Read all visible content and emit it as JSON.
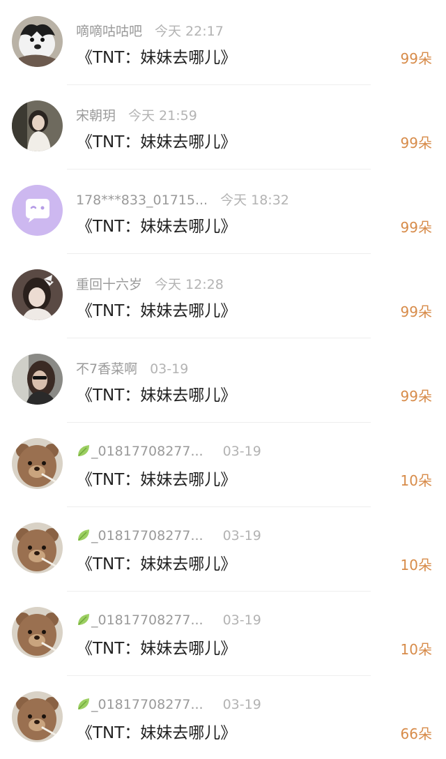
{
  "gifts": [
    {
      "username": "嘀嘀咕咕吧",
      "time": "今天 22:17",
      "title": "《TNT：妹妹去哪儿》",
      "amount": "99朵",
      "avatar_icon": "dog-avatar-icon",
      "has_leaf": false
    },
    {
      "username": "宋朝玥",
      "time": "今天 21:59",
      "title": "《TNT：妹妹去哪儿》",
      "amount": "99朵",
      "avatar_icon": "girl-photo-avatar-icon",
      "has_leaf": false
    },
    {
      "username": "178***833_01715...",
      "time": "今天 18:32",
      "title": "《TNT：妹妹去哪儿》",
      "amount": "99朵",
      "avatar_icon": "chat-bubble-avatar-icon",
      "has_leaf": false
    },
    {
      "username": "重回十六岁",
      "time": "今天 12:28",
      "title": "《TNT：妹妹去哪儿》",
      "amount": "99朵",
      "avatar_icon": "girl-bow-avatar-icon",
      "has_leaf": false
    },
    {
      "username": "不7香菜啊",
      "time": "03-19",
      "title": "《TNT：妹妹去哪儿》",
      "amount": "99朵",
      "avatar_icon": "girl-sunglasses-avatar-icon",
      "has_leaf": false
    },
    {
      "username": "_01817708277...",
      "time": "03-19",
      "title": "《TNT：妹妹去哪儿》",
      "amount": "10朵",
      "avatar_icon": "teddy-bear-avatar-icon",
      "has_leaf": true
    },
    {
      "username": "_01817708277...",
      "time": "03-19",
      "title": "《TNT：妹妹去哪儿》",
      "amount": "10朵",
      "avatar_icon": "teddy-bear-avatar-icon",
      "has_leaf": true
    },
    {
      "username": "_01817708277...",
      "time": "03-19",
      "title": "《TNT：妹妹去哪儿》",
      "amount": "10朵",
      "avatar_icon": "teddy-bear-avatar-icon",
      "has_leaf": true
    },
    {
      "username": "_01817708277...",
      "time": "03-19",
      "title": "《TNT：妹妹去哪儿》",
      "amount": "66朵",
      "avatar_icon": "teddy-bear-avatar-icon",
      "has_leaf": true
    }
  ],
  "colors": {
    "amount": "#d78b49",
    "username": "#9a9a9a",
    "title": "#222222",
    "bubble_avatar": "#cdb8f0"
  }
}
